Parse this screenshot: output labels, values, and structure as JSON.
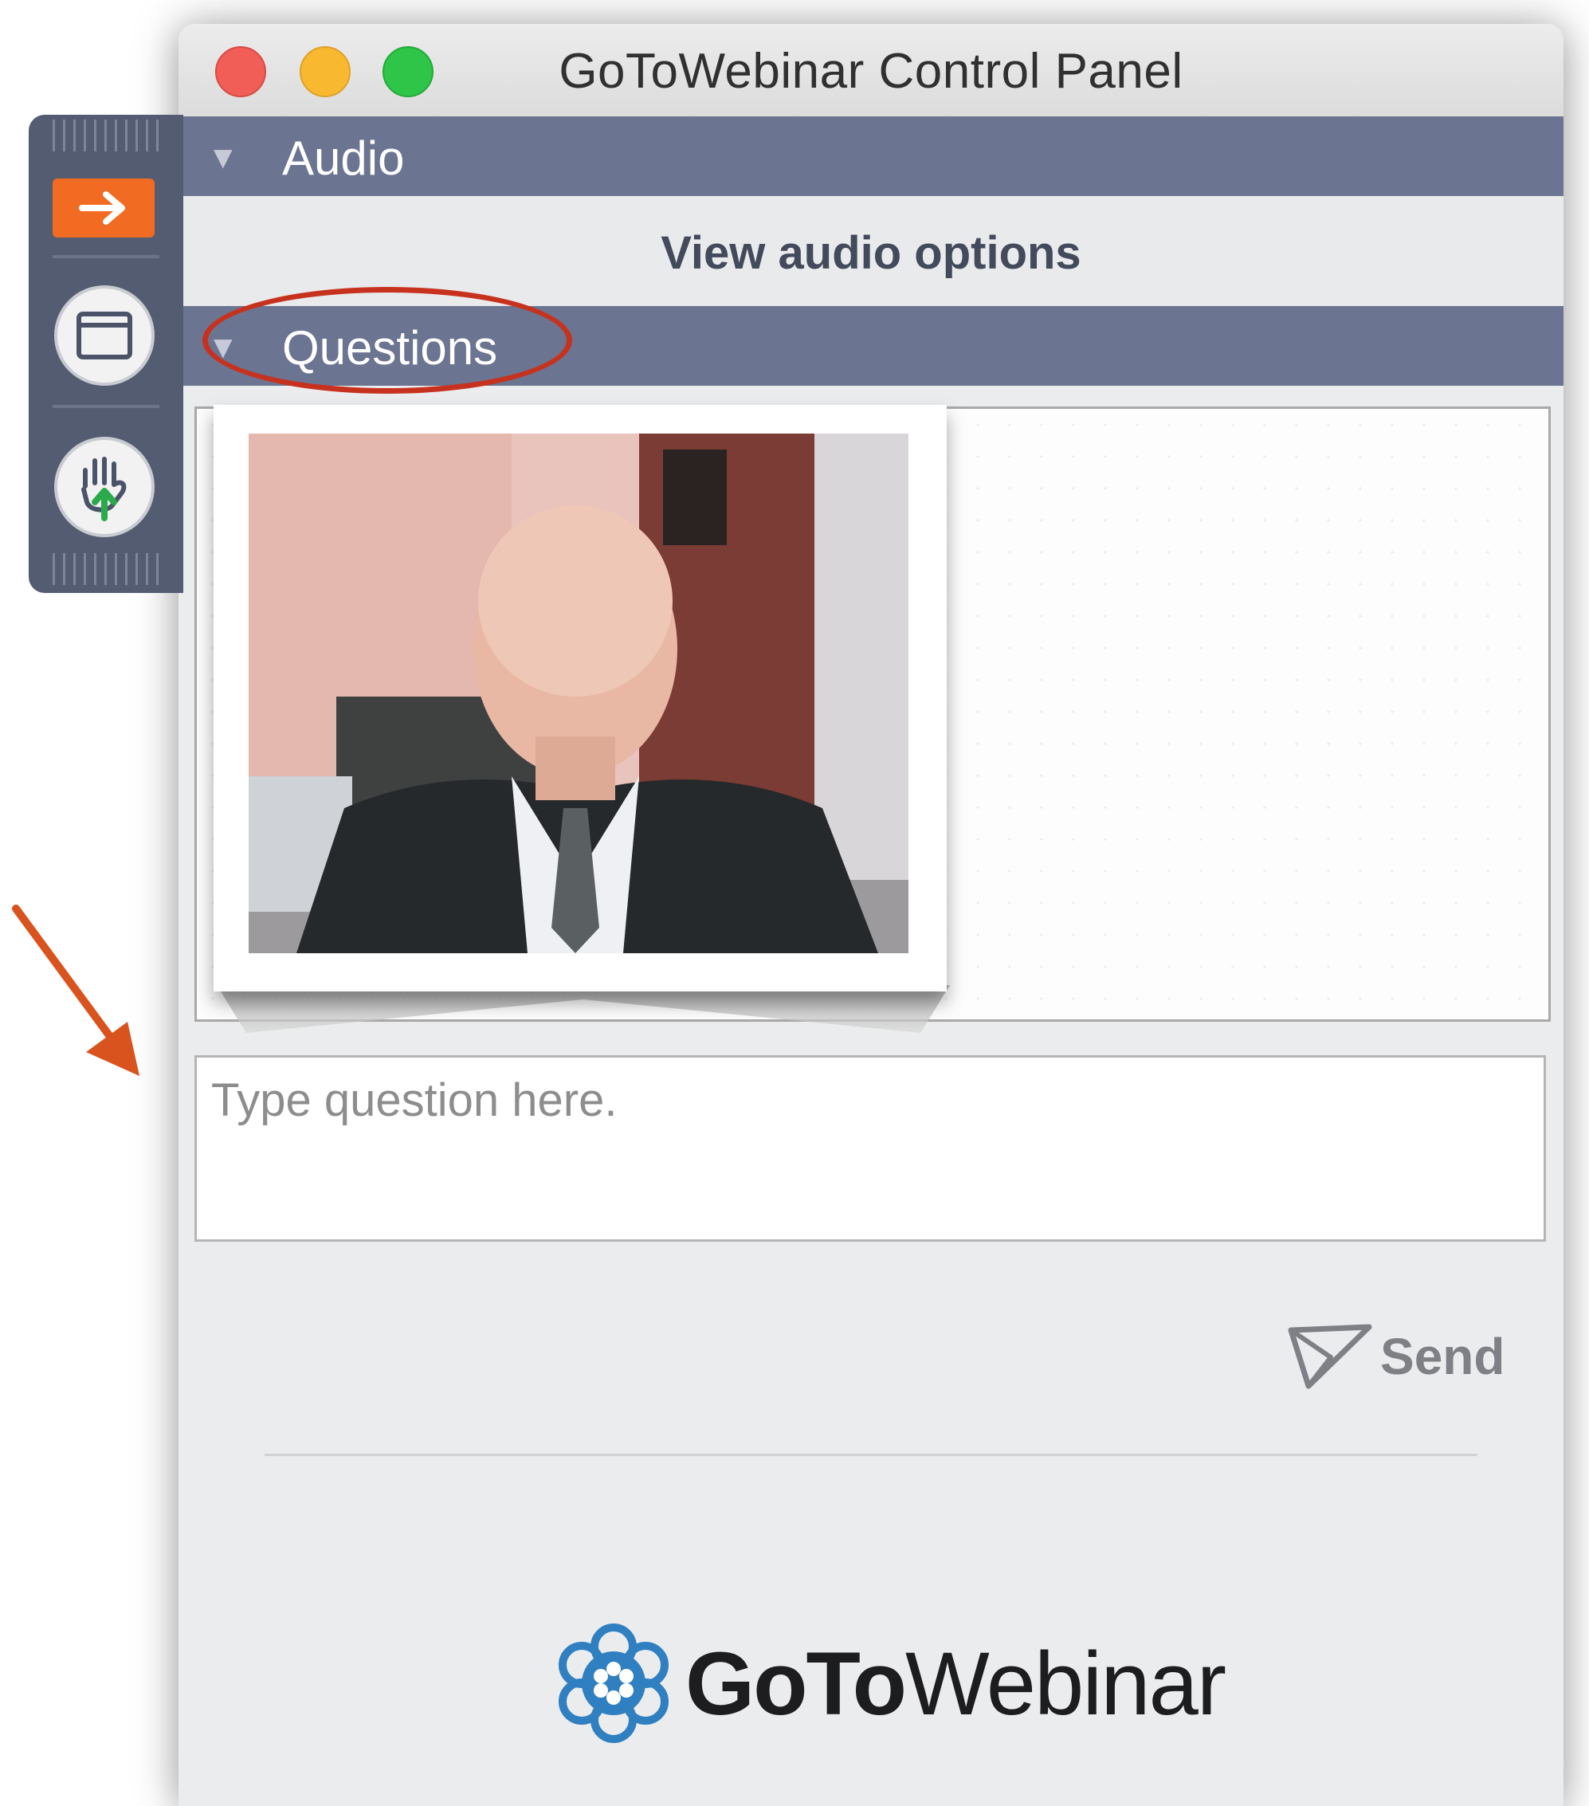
{
  "window": {
    "title": "GoToWebinar Control Panel"
  },
  "sections": {
    "audio": {
      "label": "Audio",
      "view_options_label": "View audio options"
    },
    "questions": {
      "label": "Questions",
      "input_placeholder": "Type question here.",
      "send_label": "Send"
    }
  },
  "brand": {
    "part1": "GoTo",
    "part2": "Webinar"
  },
  "toolbar": {
    "buttons": [
      "exit-arrow-icon",
      "window-icon",
      "raise-hand-icon"
    ]
  },
  "colors": {
    "section_header": "#6b7491",
    "toolbar": "#545c72",
    "exit_button": "#f26b22",
    "annotation": "#c7321e",
    "brand_blue": "#2f7fc1"
  }
}
